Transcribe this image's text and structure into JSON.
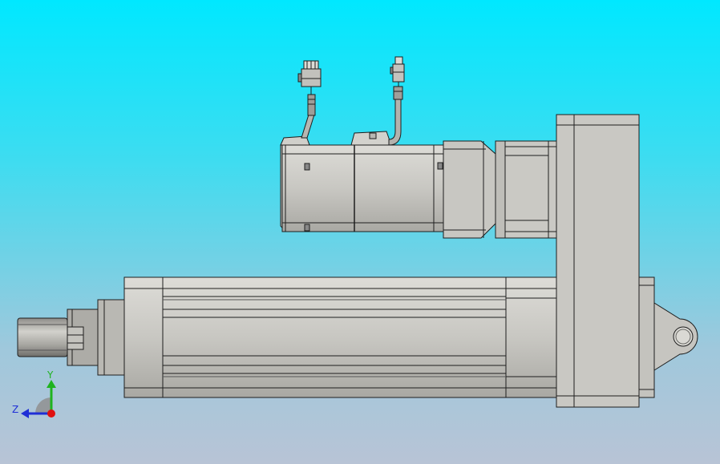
{
  "colors": {
    "background_top": "#00e8ff",
    "background_bottom": "#b8c4d6",
    "body_fill": "#c7c6c1",
    "body_light": "#d8d7d2",
    "body_dark": "#9b9a95",
    "edge": "#1e1e1e",
    "axis_y": "#1fb31f",
    "axis_z": "#1f2fd6",
    "axis_origin": "#e01010"
  },
  "triad": {
    "y_label": "Y",
    "z_label": "Z"
  }
}
